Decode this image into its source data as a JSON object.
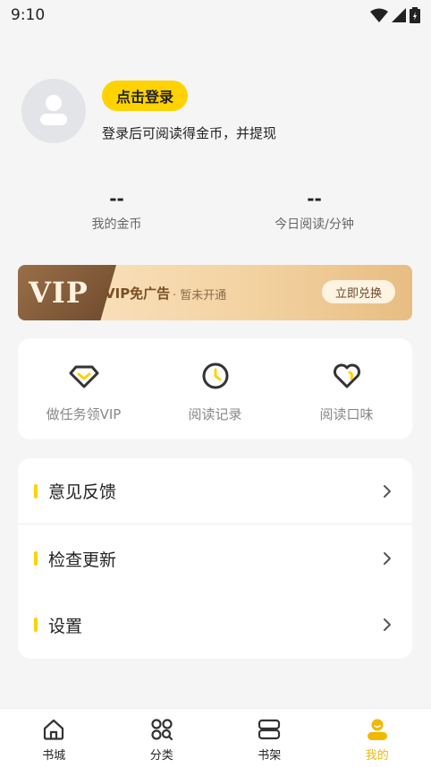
{
  "status_bar": {
    "time": "9:10"
  },
  "profile": {
    "login_button": "点击登录",
    "login_hint": "登录后可阅读得金币，并提现"
  },
  "stats": [
    {
      "value": "--",
      "label": "我的金币"
    },
    {
      "value": "--",
      "label": "今日阅读/分钟"
    }
  ],
  "vip_banner": {
    "logo": "VIP",
    "title": "VIP免广告",
    "status": "· 暂未开通",
    "redeem_button": "立即兑换"
  },
  "shortcuts": [
    {
      "icon": "diamond-check-icon",
      "label": "做任务领VIP"
    },
    {
      "icon": "clock-icon",
      "label": "阅读记录"
    },
    {
      "icon": "heart-icon",
      "label": "阅读口味"
    }
  ],
  "menu": [
    {
      "label": "意见反馈"
    },
    {
      "label": "检查更新"
    },
    {
      "label": "设置"
    }
  ],
  "bottom_nav": [
    {
      "icon": "home-icon",
      "label": "书城",
      "active": false
    },
    {
      "icon": "category-icon",
      "label": "分类",
      "active": false
    },
    {
      "icon": "bookshelf-icon",
      "label": "书架",
      "active": false
    },
    {
      "icon": "profile-icon",
      "label": "我的",
      "active": true
    }
  ],
  "colors": {
    "accent": "#ffd200",
    "active_tab": "#f2b800",
    "icon_dark": "#333333"
  }
}
